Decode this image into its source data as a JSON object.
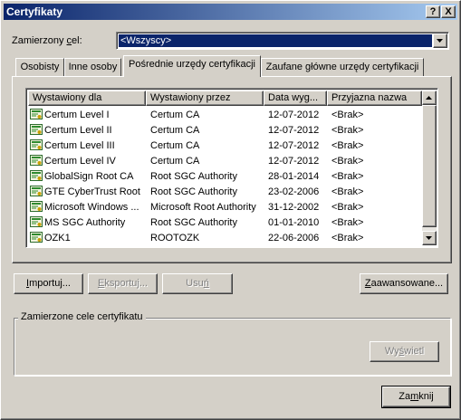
{
  "window": {
    "title": "Certyfikaty",
    "help_btn": "?",
    "close_btn": "X"
  },
  "purpose": {
    "label_prefix": "Zamierzony ",
    "label_accel": "c",
    "label_suffix": "el:",
    "value": "<Wszyscy>"
  },
  "tabs": [
    {
      "label": "Osobisty",
      "active": false
    },
    {
      "label": "Inne osoby",
      "active": false
    },
    {
      "label": "Pośrednie urzędy certyfikacji",
      "active": true
    },
    {
      "label": "Zaufane główne urzędy certyfikacji",
      "active": false
    }
  ],
  "table": {
    "columns": [
      "Wystawiony dla",
      "Wystawiony przez",
      "Data wyg...",
      "Przyjazna nazwa"
    ],
    "rows": [
      [
        "Certum Level I",
        "Certum CA",
        "12-07-2012",
        "<Brak>"
      ],
      [
        "Certum Level II",
        "Certum CA",
        "12-07-2012",
        "<Brak>"
      ],
      [
        "Certum Level III",
        "Certum CA",
        "12-07-2012",
        "<Brak>"
      ],
      [
        "Certum Level IV",
        "Certum CA",
        "12-07-2012",
        "<Brak>"
      ],
      [
        "GlobalSign Root CA",
        "Root SGC Authority",
        "28-01-2014",
        "<Brak>"
      ],
      [
        "GTE CyberTrust Root",
        "Root SGC Authority",
        "23-02-2006",
        "<Brak>"
      ],
      [
        "Microsoft Windows ...",
        "Microsoft Root Authority",
        "31-12-2002",
        "<Brak>"
      ],
      [
        "MS SGC Authority",
        "Root SGC Authority",
        "01-01-2010",
        "<Brak>"
      ],
      [
        "OZK1",
        "ROOTOZK",
        "22-06-2006",
        "<Brak>"
      ]
    ]
  },
  "buttons": {
    "import": {
      "accel": "I",
      "rest": "mportuj..."
    },
    "export": {
      "accel": "E",
      "rest": "ksportuj..."
    },
    "remove": {
      "pre": "Usu",
      "accel": "ń",
      "post": ""
    },
    "advanced": {
      "accel": "Z",
      "rest": "aawansowane..."
    },
    "view": {
      "pre": "Wy",
      "accel": "ś",
      "post": "wietl"
    },
    "close": {
      "pre": "Za",
      "accel": "m",
      "post": "knij"
    }
  },
  "group": {
    "label": "Zamierzone cele certyfikatu"
  }
}
